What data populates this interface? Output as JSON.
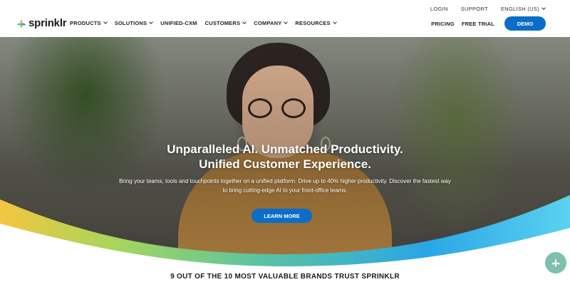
{
  "brand": {
    "name": "sprinklr",
    "accent": "#0a6ec7"
  },
  "utility_nav": [
    {
      "label": "LOGIN"
    },
    {
      "label": "SUPPORT"
    },
    {
      "label": "ENGLISH (US)",
      "icon": "chevron-down-icon"
    }
  ],
  "main_nav": [
    {
      "label": "PRODUCTS",
      "has_dropdown": true
    },
    {
      "label": "SOLUTIONS",
      "has_dropdown": true
    },
    {
      "label": "UNIFIED-CXM",
      "has_dropdown": false
    },
    {
      "label": "CUSTOMERS",
      "has_dropdown": true
    },
    {
      "label": "COMPANY",
      "has_dropdown": true
    },
    {
      "label": "RESOURCES",
      "has_dropdown": true
    }
  ],
  "actions": {
    "pricing": "PRICING",
    "free_trial": "FREE TRIAL",
    "demo": "DEMO"
  },
  "hero": {
    "title_line1": "Unparalleled AI. Unmatched Productivity.",
    "title_line2": "Unified Customer Experience.",
    "sub_line1": "Bring your teams, tools and touchpoints together on a unified platform. Drive up to 40% higher productivity. Discover the fastest way",
    "sub_line2": "to bring cutting-edge AI to your front-office teams.",
    "cta": "LEARN MORE"
  },
  "trust_heading": "9 OUT OF THE 10 MOST VALUABLE BRANDS TRUST SPRINKLR",
  "chat_icon": "chat-assistant-icon"
}
